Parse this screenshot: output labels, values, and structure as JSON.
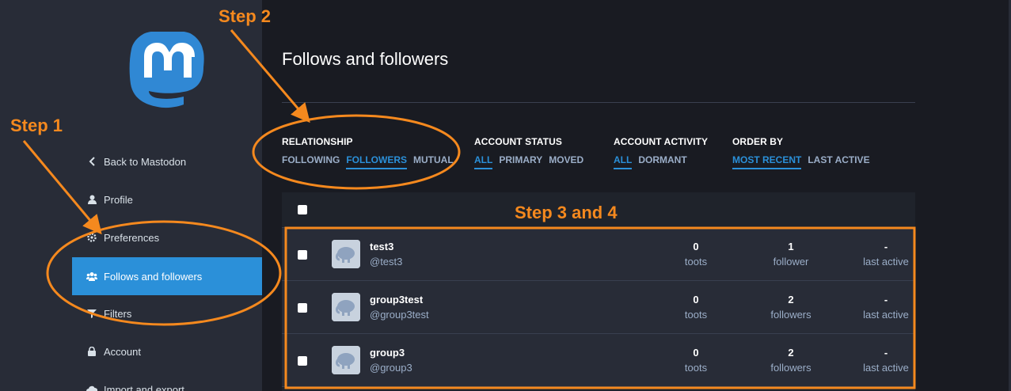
{
  "sidebar": {
    "items": [
      {
        "label": "Back to Mastodon",
        "icon": "chevron-left-icon"
      },
      {
        "label": "Profile",
        "icon": "user-icon"
      },
      {
        "label": "Preferences",
        "icon": "cog-icon"
      },
      {
        "label": "Follows and followers",
        "icon": "users-icon"
      },
      {
        "label": "Filters",
        "icon": "filter-icon"
      },
      {
        "label": "Account",
        "icon": "lock-icon"
      },
      {
        "label": "Import and export",
        "icon": "cloud-icon"
      }
    ]
  },
  "main": {
    "title": "Follows and followers",
    "filters": [
      {
        "heading": "RELATIONSHIP",
        "options": [
          "FOLLOWING",
          "FOLLOWERS",
          "MUTUAL"
        ],
        "selected": "FOLLOWERS"
      },
      {
        "heading": "ACCOUNT STATUS",
        "options": [
          "ALL",
          "PRIMARY",
          "MOVED"
        ],
        "selected": "ALL"
      },
      {
        "heading": "ACCOUNT ACTIVITY",
        "options": [
          "ALL",
          "DORMANT"
        ],
        "selected": "ALL"
      },
      {
        "heading": "ORDER BY",
        "options": [
          "MOST RECENT",
          "LAST ACTIVE"
        ],
        "selected": "MOST RECENT"
      }
    ],
    "rows": [
      {
        "display_name": "test3",
        "username": "@test3",
        "toots": "0",
        "toots_label": "toots",
        "followers": "1",
        "followers_label": "follower",
        "last_active": "-",
        "last_active_label": "last active"
      },
      {
        "display_name": "group3test",
        "username": "@group3test",
        "toots": "0",
        "toots_label": "toots",
        "followers": "2",
        "followers_label": "followers",
        "last_active": "-",
        "last_active_label": "last active"
      },
      {
        "display_name": "group3",
        "username": "@group3",
        "toots": "0",
        "toots_label": "toots",
        "followers": "2",
        "followers_label": "followers",
        "last_active": "-",
        "last_active_label": "last active"
      }
    ]
  },
  "annotations": {
    "step1": "Step 1",
    "step2": "Step 2",
    "step3": "Step 3 and 4",
    "color": "#f5891e"
  },
  "colors": {
    "accent": "#2b90d9",
    "sidebar_bg": "#282c37",
    "main_bg": "#191b22"
  }
}
